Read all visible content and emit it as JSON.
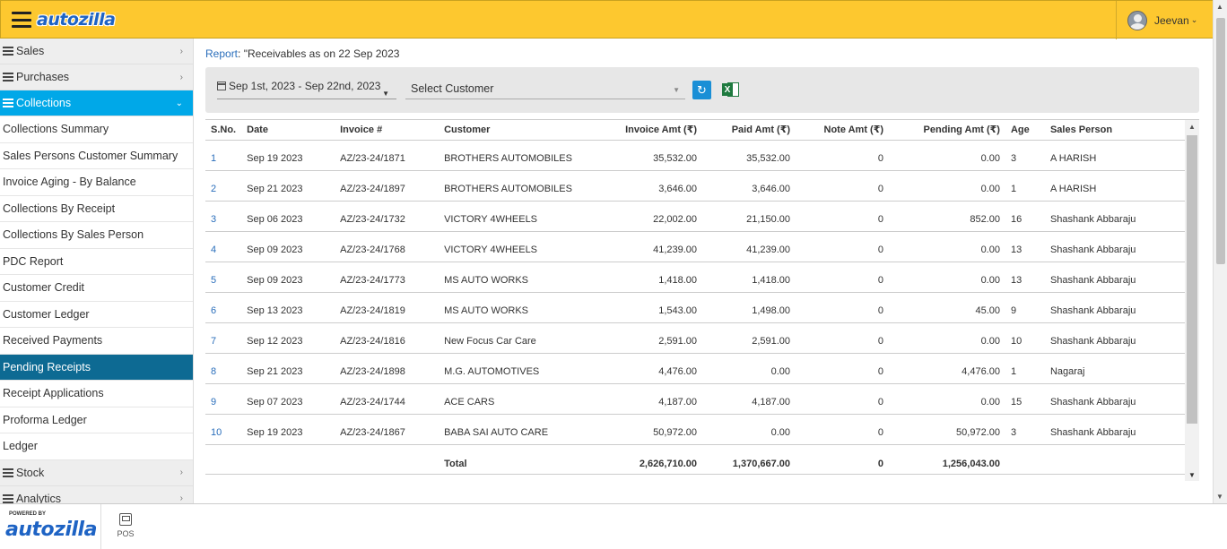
{
  "header": {
    "logo_text": "autozilla",
    "user_name": "Jeevan",
    "user_caret": "⌄"
  },
  "sidebar": {
    "groups_top": [
      {
        "label": "Sales",
        "chev": "›"
      },
      {
        "label": "Purchases",
        "chev": "›"
      }
    ],
    "active_group": {
      "label": "Collections",
      "chev": "⌄"
    },
    "items": [
      {
        "label": "Collections Summary"
      },
      {
        "label": "Sales Persons Customer Summary"
      },
      {
        "label": "Invoice Aging - By Balance"
      },
      {
        "label": "Collections By Receipt"
      },
      {
        "label": "Collections By Sales Person"
      },
      {
        "label": "PDC Report"
      },
      {
        "label": "Customer Credit"
      },
      {
        "label": "Customer Ledger"
      },
      {
        "label": "Received Payments"
      },
      {
        "label": "Pending Receipts"
      },
      {
        "label": "Receipt Applications"
      },
      {
        "label": "Proforma Ledger"
      },
      {
        "label": "Ledger"
      }
    ],
    "groups_bottom": [
      {
        "label": "Stock",
        "chev": "›"
      },
      {
        "label": "Analytics",
        "chev": "›"
      }
    ]
  },
  "breadcrumb": {
    "link": "Report",
    "separator": ":",
    "title": " \"Receivables as on 22 Sep 2023"
  },
  "filters": {
    "date_range": "Sep 1st, 2023 - Sep 22nd, 2023",
    "customer_placeholder": "Select Customer"
  },
  "table": {
    "headers": {
      "sno": "S.No.",
      "date": "Date",
      "invoice": "Invoice #",
      "customer": "Customer",
      "invoice_amt": "Invoice Amt (₹)",
      "paid_amt": "Paid Amt (₹)",
      "note_amt": "Note Amt (₹)",
      "pending_amt": "Pending Amt (₹)",
      "age": "Age",
      "sales_person": "Sales Person"
    },
    "rows": [
      {
        "sno": "1",
        "date": "Sep 19 2023",
        "invoice": "AZ/23-24/1871",
        "customer": "BROTHERS AUTOMOBILES",
        "invoice_amt": "35,532.00",
        "paid_amt": "35,532.00",
        "note_amt": "0",
        "pending_amt": "0.00",
        "age": "3",
        "sales_person": "A HARISH"
      },
      {
        "sno": "2",
        "date": "Sep 21 2023",
        "invoice": "AZ/23-24/1897",
        "customer": "BROTHERS AUTOMOBILES",
        "invoice_amt": "3,646.00",
        "paid_amt": "3,646.00",
        "note_amt": "0",
        "pending_amt": "0.00",
        "age": "1",
        "sales_person": "A HARISH"
      },
      {
        "sno": "3",
        "date": "Sep 06 2023",
        "invoice": "AZ/23-24/1732",
        "customer": "VICTORY 4WHEELS",
        "invoice_amt": "22,002.00",
        "paid_amt": "21,150.00",
        "note_amt": "0",
        "pending_amt": "852.00",
        "age": "16",
        "sales_person": "Shashank Abbaraju"
      },
      {
        "sno": "4",
        "date": "Sep 09 2023",
        "invoice": "AZ/23-24/1768",
        "customer": "VICTORY 4WHEELS",
        "invoice_amt": "41,239.00",
        "paid_amt": "41,239.00",
        "note_amt": "0",
        "pending_amt": "0.00",
        "age": "13",
        "sales_person": "Shashank Abbaraju"
      },
      {
        "sno": "5",
        "date": "Sep 09 2023",
        "invoice": "AZ/23-24/1773",
        "customer": "MS AUTO WORKS",
        "invoice_amt": "1,418.00",
        "paid_amt": "1,418.00",
        "note_amt": "0",
        "pending_amt": "0.00",
        "age": "13",
        "sales_person": "Shashank Abbaraju"
      },
      {
        "sno": "6",
        "date": "Sep 13 2023",
        "invoice": "AZ/23-24/1819",
        "customer": "MS AUTO WORKS",
        "invoice_amt": "1,543.00",
        "paid_amt": "1,498.00",
        "note_amt": "0",
        "pending_amt": "45.00",
        "age": "9",
        "sales_person": "Shashank Abbaraju"
      },
      {
        "sno": "7",
        "date": "Sep 12 2023",
        "invoice": "AZ/23-24/1816",
        "customer": "New Focus Car Care",
        "invoice_amt": "2,591.00",
        "paid_amt": "2,591.00",
        "note_amt": "0",
        "pending_amt": "0.00",
        "age": "10",
        "sales_person": "Shashank Abbaraju"
      },
      {
        "sno": "8",
        "date": "Sep 21 2023",
        "invoice": "AZ/23-24/1898",
        "customer": "M.G. AUTOMOTIVES",
        "invoice_amt": "4,476.00",
        "paid_amt": "0.00",
        "note_amt": "0",
        "pending_amt": "4,476.00",
        "age": "1",
        "sales_person": "Nagaraj"
      },
      {
        "sno": "9",
        "date": "Sep 07 2023",
        "invoice": "AZ/23-24/1744",
        "customer": "ACE CARS",
        "invoice_amt": "4,187.00",
        "paid_amt": "4,187.00",
        "note_amt": "0",
        "pending_amt": "0.00",
        "age": "15",
        "sales_person": "Shashank Abbaraju"
      },
      {
        "sno": "10",
        "date": "Sep 19 2023",
        "invoice": "AZ/23-24/1867",
        "customer": "BABA SAI AUTO CARE",
        "invoice_amt": "50,972.00",
        "paid_amt": "0.00",
        "note_amt": "0",
        "pending_amt": "50,972.00",
        "age": "3",
        "sales_person": "Shashank Abbaraju"
      }
    ],
    "total": {
      "label": "Total",
      "invoice_amt": "2,626,710.00",
      "paid_amt": "1,370,667.00",
      "note_amt": "0",
      "pending_amt": "1,256,043.00"
    }
  },
  "footer": {
    "powered_by": "POWERED BY",
    "logo_text": "autozilla",
    "pos_label": "POS"
  },
  "icons": {
    "menu": "hamburger-menu-icon",
    "calendar": "calendar-icon",
    "refresh": "refresh-icon",
    "excel": "excel-export-icon",
    "pos": "pos-terminal-icon"
  },
  "colors": {
    "header_bg": "#fdc82f",
    "active_group_bg": "#00a8e8",
    "active_item_bg": "#0d6a93",
    "link": "#2a6ebb",
    "refresh_btn": "#1a8fd6",
    "excel_green": "#1f7a3f"
  }
}
